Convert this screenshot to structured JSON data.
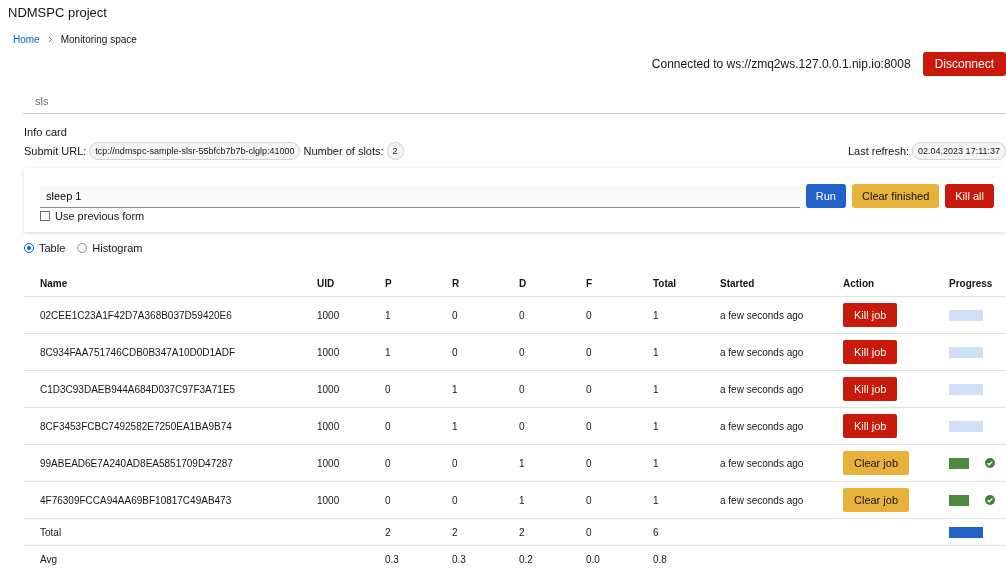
{
  "header": {
    "title": "NDMSPC project"
  },
  "breadcrumb": [
    {
      "label": "Home",
      "link": true
    },
    {
      "label": "Monitoring space",
      "link": false
    }
  ],
  "connection": {
    "text": "Connected to ws://zmq2ws.127.0.0.1.nip.io:8008",
    "button": "Disconnect"
  },
  "tabs": [
    {
      "label": "sls",
      "selected": false
    }
  ],
  "info_card": {
    "title": "Info card",
    "submit_label": "Submit URL:",
    "submit_url": "tcp://ndmspc-sample-slsr-55bfcb7b7b-clglp:41000",
    "slots_label": "Number of slots:",
    "slots": "2",
    "refresh_label": "Last refresh:",
    "refresh": "02.04.2023 17:11:37"
  },
  "form": {
    "command": "sleep 1",
    "use_previous": {
      "label": "Use previous form",
      "checked": false
    },
    "buttons": [
      {
        "label": "Run",
        "kind": "primary"
      },
      {
        "label": "Clear finished",
        "kind": "warning"
      },
      {
        "label": "Kill all",
        "kind": "danger"
      }
    ]
  },
  "views": [
    {
      "label": "Table",
      "selected": true
    },
    {
      "label": "Histogram",
      "selected": false
    }
  ],
  "table": {
    "columns": [
      "Name",
      "UID",
      "P",
      "R",
      "D",
      "F",
      "Total",
      "Started",
      "Action",
      "Progress"
    ],
    "rows": [
      {
        "name": "02CEE1C23A1F42D7A368B037D59420E6",
        "uid": "1000",
        "p": "1",
        "r": "0",
        "d": "0",
        "f": "0",
        "total": "1",
        "started": "a few seconds ago",
        "action": {
          "label": "Kill job",
          "kind": "kill"
        },
        "done": false
      },
      {
        "name": "8C934FAA751746CDB0B347A10D0D1ADF",
        "uid": "1000",
        "p": "1",
        "r": "0",
        "d": "0",
        "f": "0",
        "total": "1",
        "started": "a few seconds ago",
        "action": {
          "label": "Kill job",
          "kind": "kill"
        },
        "done": false
      },
      {
        "name": "C1D3C93DAEB944A684D037C97F3A71E5",
        "uid": "1000",
        "p": "0",
        "r": "1",
        "d": "0",
        "f": "0",
        "total": "1",
        "started": "a few seconds ago",
        "action": {
          "label": "Kill job",
          "kind": "kill"
        },
        "done": false
      },
      {
        "name": "8CF3453FCBC7492582E7250EA1BA9B74",
        "uid": "1000",
        "p": "0",
        "r": "1",
        "d": "0",
        "f": "0",
        "total": "1",
        "started": "a few seconds ago",
        "action": {
          "label": "Kill job",
          "kind": "kill"
        },
        "done": false
      },
      {
        "name": "99ABEAD6E7A240AD8EA5851709D47287",
        "uid": "1000",
        "p": "0",
        "r": "0",
        "d": "1",
        "f": "0",
        "total": "1",
        "started": "a few seconds ago",
        "action": {
          "label": "Clear job",
          "kind": "clear"
        },
        "done": true
      },
      {
        "name": "4F76309FCCA94AA69BF10817C49AB473",
        "uid": "1000",
        "p": "0",
        "r": "0",
        "d": "1",
        "f": "0",
        "total": "1",
        "started": "a few seconds ago",
        "action": {
          "label": "Clear job",
          "kind": "clear"
        },
        "done": true
      }
    ],
    "summary": [
      {
        "label": "Total",
        "p": "2",
        "r": "2",
        "d": "2",
        "f": "0",
        "total": "6",
        "bar": true
      },
      {
        "label": "Avg",
        "p": "0.3",
        "r": "0.3",
        "d": "0.2",
        "f": "0.0",
        "total": "0.8",
        "bar": false
      }
    ]
  }
}
